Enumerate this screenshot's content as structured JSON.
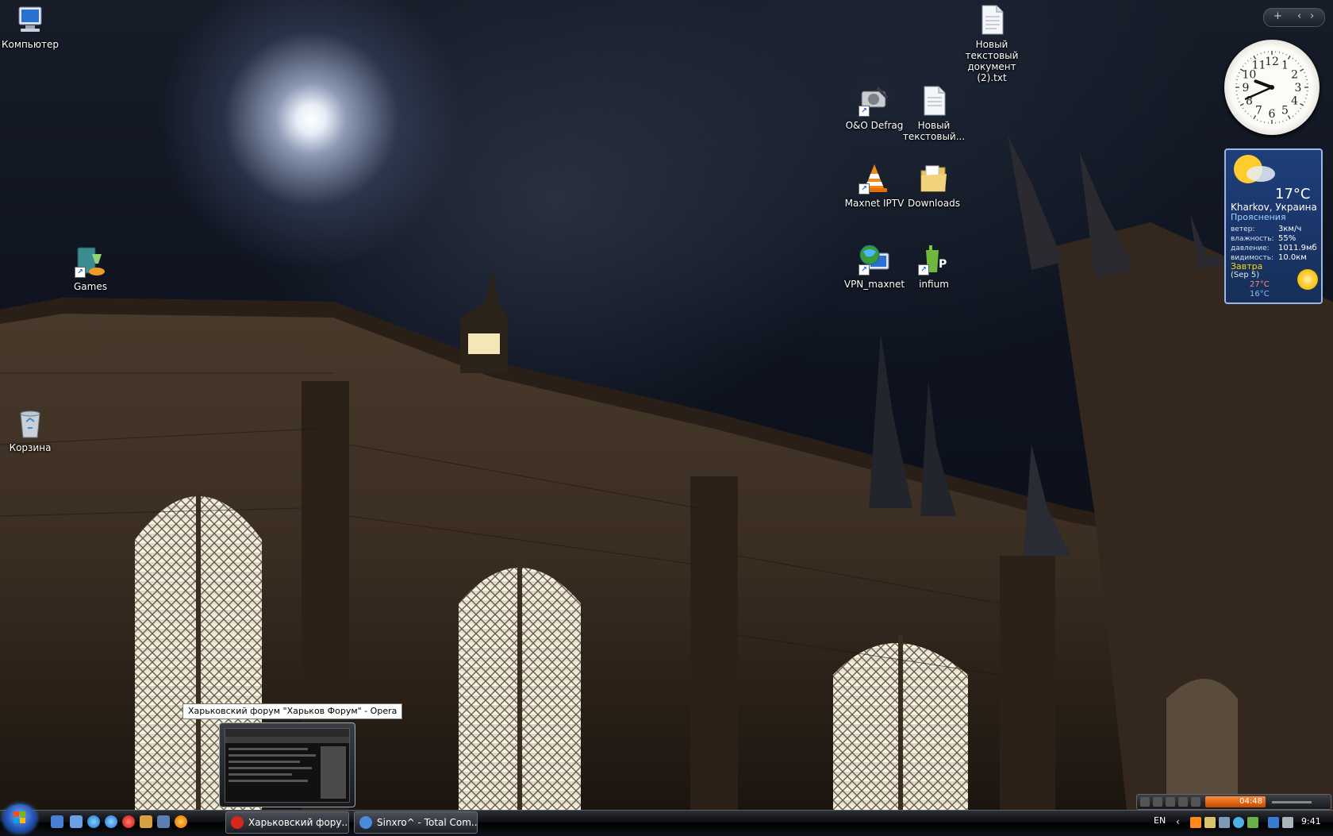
{
  "desktop": {
    "icons": [
      {
        "label": "Компьютер",
        "icon": "computer-icon"
      },
      {
        "label": "Новый текстовый документ (2).txt",
        "icon": "text-file-icon"
      },
      {
        "label": "O&O Defrag",
        "icon": "defrag-icon"
      },
      {
        "label": "Новый текстовый...",
        "icon": "text-file-icon"
      },
      {
        "label": "Games",
        "icon": "games-icon"
      },
      {
        "label": "Maxnet IPTV",
        "icon": "vlc-cone-icon"
      },
      {
        "label": "Downloads",
        "icon": "folder-icon"
      },
      {
        "label": "VPN_maxnet",
        "icon": "network-globe-icon"
      },
      {
        "label": "infium",
        "icon": "infium-icon"
      },
      {
        "label": "Корзина",
        "icon": "recycle-bin-icon"
      }
    ]
  },
  "sidebar": {
    "add_label": "+",
    "prev_label": "‹",
    "next_label": "›",
    "clock": {
      "numbers": [
        "12",
        "1",
        "2",
        "3",
        "4",
        "5",
        "6",
        "7",
        "8",
        "9",
        "10",
        "11"
      ],
      "hour": 9,
      "minute": 41
    },
    "weather": {
      "temperature": "17°C",
      "city": "Kharkov, Украина",
      "condition": "Прояснения",
      "rows": [
        {
          "key": "ветер:",
          "value": "3км/ч"
        },
        {
          "key": "влажность:",
          "value": "55%"
        },
        {
          "key": "давление:",
          "value": "1011.9мб"
        },
        {
          "key": "видимость:",
          "value": "10.0км"
        }
      ],
      "tomorrow_label": "Завтра",
      "tomorrow_date": "(Sep 5)",
      "tomorrow_high": "27°C",
      "tomorrow_low": "16°C"
    }
  },
  "tooltip": {
    "text": "Харьковский форум \"Харьков Форум\" - Opera"
  },
  "media_toolbar": {
    "time": "04:48"
  },
  "taskbar": {
    "tasks": [
      {
        "label": "Харьковский фору...",
        "icon": "opera-icon",
        "color": "#d6261d"
      },
      {
        "label": "Sinxro^ - Total Com...",
        "icon": "total-commander-icon",
        "color": "#4b8ad8"
      }
    ],
    "language": "EN",
    "clock": "9:41"
  }
}
